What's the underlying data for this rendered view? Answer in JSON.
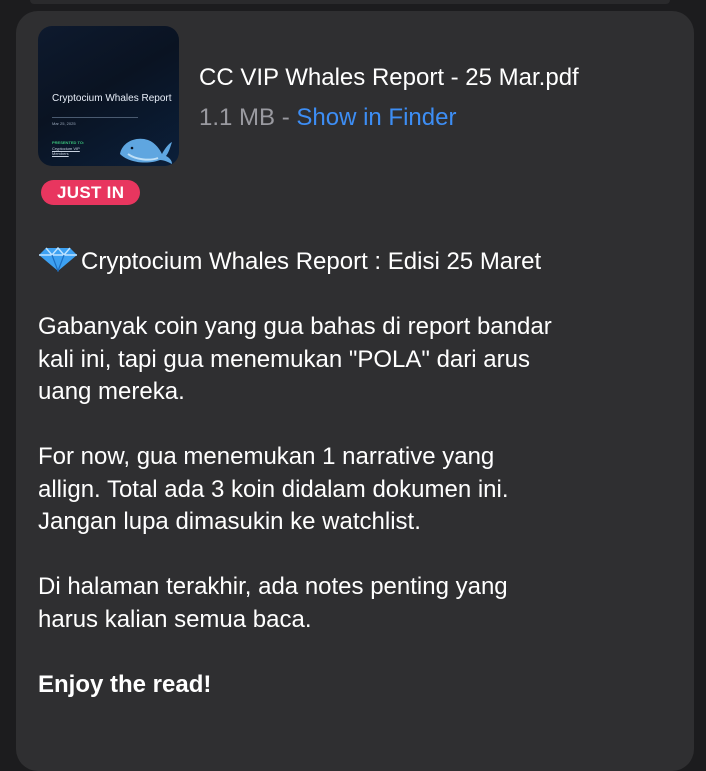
{
  "attachment": {
    "thumbnail": {
      "title": "Cryptocium Whales Report",
      "date": "Mar 25, 2025",
      "presented_to": "PRESENTED TO:",
      "audience": "Cryptocium VIP Members"
    },
    "file_name": "CC VIP Whales Report - 25 Mar.pdf",
    "file_size": "1.1 MB",
    "separator": "-",
    "show_in_finder": "Show in Finder"
  },
  "badge": {
    "label": "JUST IN",
    "color": "#e8365f"
  },
  "message": {
    "icon": "gem-icon",
    "headline": "Cryptocium Whales Report : Edisi 25 Maret",
    "paragraphs": [
      "Gabanyak coin yang gua bahas di report bandar kali ini, tapi gua menemukan \"POLA\" dari arus uang mereka.",
      "For now, gua menemukan 1 narrative yang allign. Total ada 3 koin didalam dokumen ini. Jangan lupa dimasukin ke watchlist.",
      "Di halaman terakhir, ada notes penting yang harus kalian semua baca."
    ],
    "closing": "Enjoy the read!"
  },
  "colors": {
    "background": "#1c1c1e",
    "bubble": "#2f2f31",
    "link": "#3d8ef5",
    "muted_text": "#9a9aa0"
  }
}
